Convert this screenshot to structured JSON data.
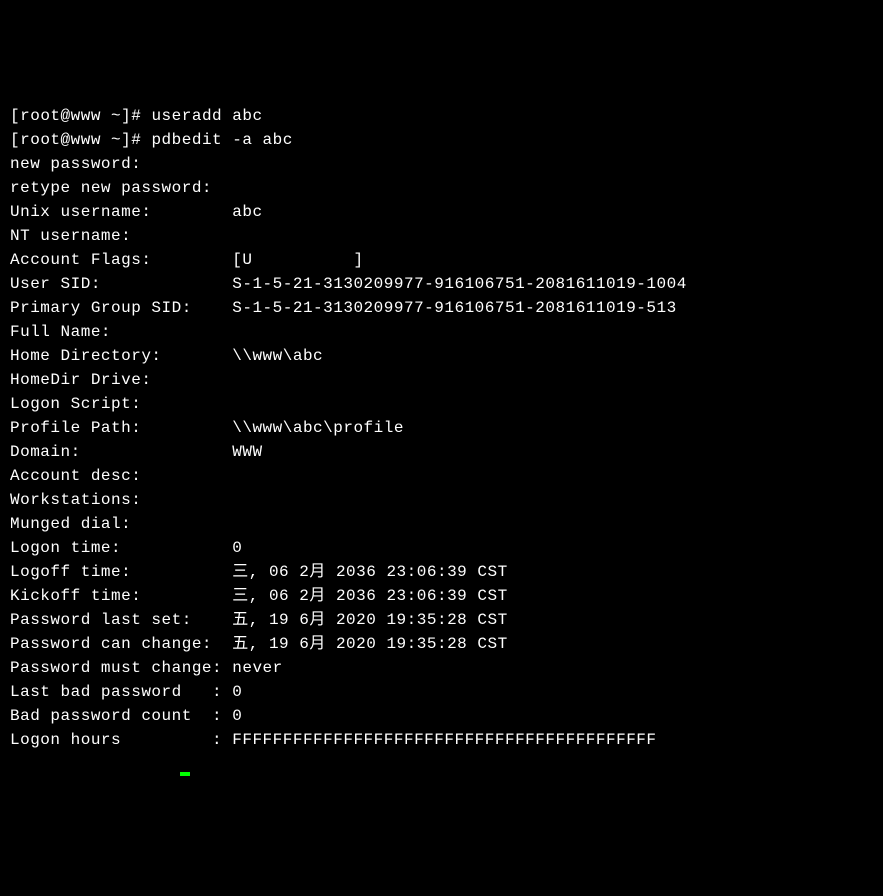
{
  "term": {
    "prompt1_open": "[",
    "prompt1_user": "root@www",
    "prompt1_path": " ~",
    "prompt1_close": "]# ",
    "cmd1": "useradd abc",
    "prompt2_open": "[",
    "prompt2_user": "root@www",
    "prompt2_path": " ~",
    "prompt2_close": "]# ",
    "cmd2": "pdbedit -a abc",
    "line_newpass": "new password:",
    "line_retype": "retype new password:",
    "label_unix_username": "Unix username:        ",
    "val_unix_username": "abc",
    "label_nt_username": "NT username:",
    "val_nt_username": "",
    "label_account_flags": "Account Flags:        ",
    "val_account_flags": "[U          ]",
    "label_user_sid": "User SID:             ",
    "val_user_sid": "S-1-5-21-3130209977-916106751-2081611019-1004",
    "label_primary_group_sid": "Primary Group SID:    ",
    "val_primary_group_sid": "S-1-5-21-3130209977-916106751-2081611019-513",
    "label_full_name": "Full Name:",
    "val_full_name": "",
    "label_home_directory": "Home Directory:       ",
    "val_home_directory": "\\\\www\\abc",
    "label_homedir_drive": "HomeDir Drive:",
    "val_homedir_drive": "",
    "label_logon_script": "Logon Script:",
    "val_logon_script": "",
    "label_profile_path": "Profile Path:         ",
    "val_profile_path": "\\\\www\\abc\\profile",
    "label_domain": "Domain:               ",
    "val_domain": "WWW",
    "label_account_desc": "Account desc:",
    "val_account_desc": "",
    "label_workstations": "Workstations:",
    "val_workstations": "",
    "label_munged_dial": "Munged dial:",
    "val_munged_dial": "",
    "label_logon_time": "Logon time:           ",
    "val_logon_time": "0",
    "label_logoff_time": "Logoff time:          ",
    "val_logoff_time": "三, 06 2月 2036 23:06:39 CST",
    "label_kickoff_time": "Kickoff time:         ",
    "val_kickoff_time": "三, 06 2月 2036 23:06:39 CST",
    "label_password_last_set": "Password last set:    ",
    "val_password_last_set": "五, 19 6月 2020 19:35:28 CST",
    "label_password_can_change": "Password can change:  ",
    "val_password_can_change": "五, 19 6月 2020 19:35:28 CST",
    "label_password_must_change": "Password must change: ",
    "val_password_must_change": "never",
    "label_last_bad_password": "Last bad password   : ",
    "val_last_bad_password": "0",
    "label_bad_password_count": "Bad password count  : ",
    "val_bad_password_count": "0",
    "label_logon_hours": "Logon hours         : ",
    "val_logon_hours": "FFFFFFFFFFFFFFFFFFFFFFFFFFFFFFFFFFFFFFFFFF"
  }
}
